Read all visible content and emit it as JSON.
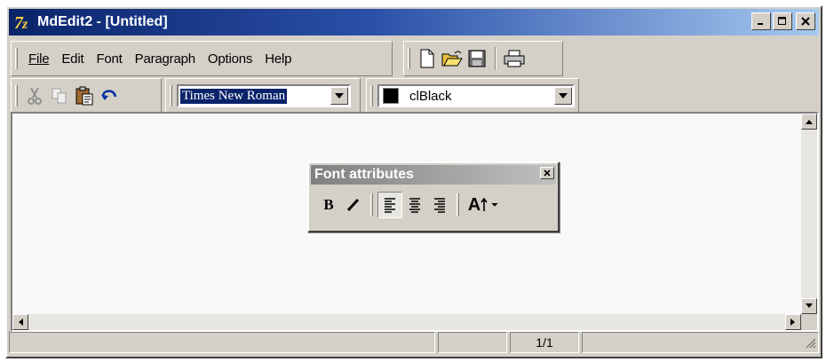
{
  "window": {
    "title": "MdEdit2 - [Untitled]",
    "controls": {
      "minimize": "_",
      "maximize": "□",
      "close": "×"
    }
  },
  "menu": {
    "items": [
      {
        "label": "File",
        "underline": "F"
      },
      {
        "label": "Edit",
        "underline": "E"
      },
      {
        "label": "Font",
        "underline": "F"
      },
      {
        "label": "Paragraph",
        "underline": "P"
      },
      {
        "label": "Options",
        "underline": "O"
      },
      {
        "label": "Help",
        "underline": "H"
      }
    ]
  },
  "toolbar_file": {
    "icons": [
      "new-document-icon",
      "open-folder-icon",
      "save-icon",
      "print-icon"
    ]
  },
  "toolbar_edit": {
    "icons": [
      "cut-icon",
      "copy-icon",
      "paste-icon",
      "undo-icon"
    ]
  },
  "font_combo": {
    "value": "Times New Roman"
  },
  "color_combo": {
    "value": "clBlack",
    "swatch": "#000000"
  },
  "font_attributes": {
    "title": "Font attributes",
    "bold_label": "B",
    "size_label": "A"
  },
  "status_bar": {
    "page": "1/1"
  },
  "colors": {
    "title_bar_start": "#0a246a",
    "title_bar_end": "#a6caf0",
    "face": "#d4d0c8"
  }
}
